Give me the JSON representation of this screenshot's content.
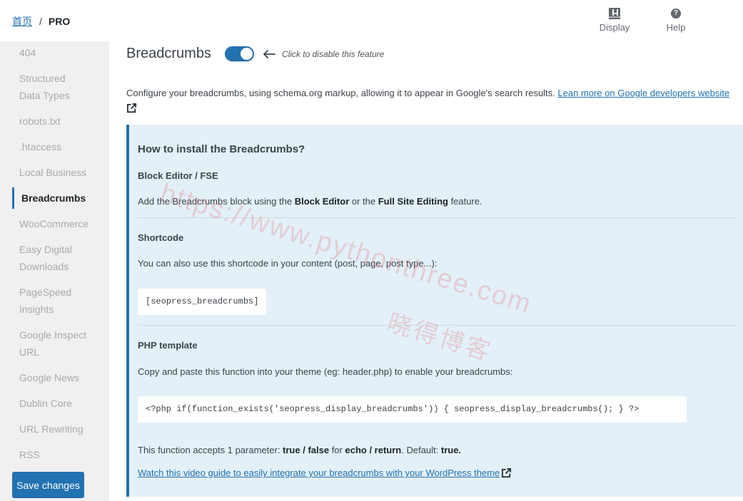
{
  "breadcrumb": {
    "home": "首页",
    "separator": "/",
    "current": "PRO"
  },
  "top_actions": [
    {
      "label": "Display",
      "icon": "display-layout-icon"
    },
    {
      "label": "Help",
      "icon": "help-circle-icon"
    }
  ],
  "sidebar": {
    "items": [
      {
        "label": "404",
        "active": false
      },
      {
        "label": "Structured Data Types",
        "lines": [
          "Structured",
          "Data Types"
        ],
        "active": false
      },
      {
        "label": "robots.txt",
        "active": false
      },
      {
        "label": ".htaccess",
        "active": false
      },
      {
        "label": "Local Business",
        "active": false
      },
      {
        "label": "Breadcrumbs",
        "active": true
      },
      {
        "label": "WooCommerce",
        "active": false
      },
      {
        "label": "Easy Digital Downloads",
        "lines": [
          "Easy Digital",
          "Downloads"
        ],
        "active": false
      },
      {
        "label": "PageSpeed Insights",
        "lines": [
          "PageSpeed",
          "Insights"
        ],
        "active": false
      },
      {
        "label": "Google Inspect URL",
        "lines": [
          "Google Inspect",
          "URL"
        ],
        "active": false
      },
      {
        "label": "Google News",
        "active": false
      },
      {
        "label": "Dublin Core",
        "active": false
      },
      {
        "label": "URL Rewriting",
        "active": false
      },
      {
        "label": "RSS",
        "active": false
      }
    ],
    "save_label": "Save changes"
  },
  "feature": {
    "title": "Breadcrumbs",
    "enabled": true,
    "toggle_hint": "Click to disable this feature"
  },
  "intro": {
    "text": "Configure your breadcrumbs, using schema.org markup, allowing it to appear in Google's search results.",
    "link_label": "Lean more on Google developers website"
  },
  "install": {
    "title": "How to install the Breadcrumbs?",
    "block_editor": {
      "heading": "Block Editor / FSE",
      "text_pre": "Add the Breadcrumbs block using the ",
      "bold1": "Block Editor",
      "text_mid": " or the ",
      "bold2": "Full Site Editing",
      "text_post": " feature."
    },
    "shortcode": {
      "heading": "Shortcode",
      "text": "You can also use this shortcode in your content (post, page, post type...):",
      "code": "[seopress_breadcrumbs]"
    },
    "php": {
      "heading": "PHP template",
      "text": "Copy and paste this function into your theme (eg: header.php) to enable your breadcrumbs:",
      "code": "<?php if(function_exists('seopress_display_breadcrumbs')) { seopress_display_breadcrumbs(); } ?>",
      "param_pre": "This function accepts 1 parameter: ",
      "param_b1": "true / false",
      "param_mid": " for ",
      "param_b2": "echo / return",
      "param_post": ". Default: ",
      "param_b3": "true.",
      "video_link": "Watch this video guide to easily integrate your breadcrumbs with your WordPress theme"
    }
  },
  "watermark": {
    "url": "https://www.pythonthree.com",
    "cn": "晓得博客"
  },
  "colors": {
    "accent": "#2271b1",
    "info_bg": "#e3f0f8",
    "sidebar_bg": "#f0f0f1"
  }
}
